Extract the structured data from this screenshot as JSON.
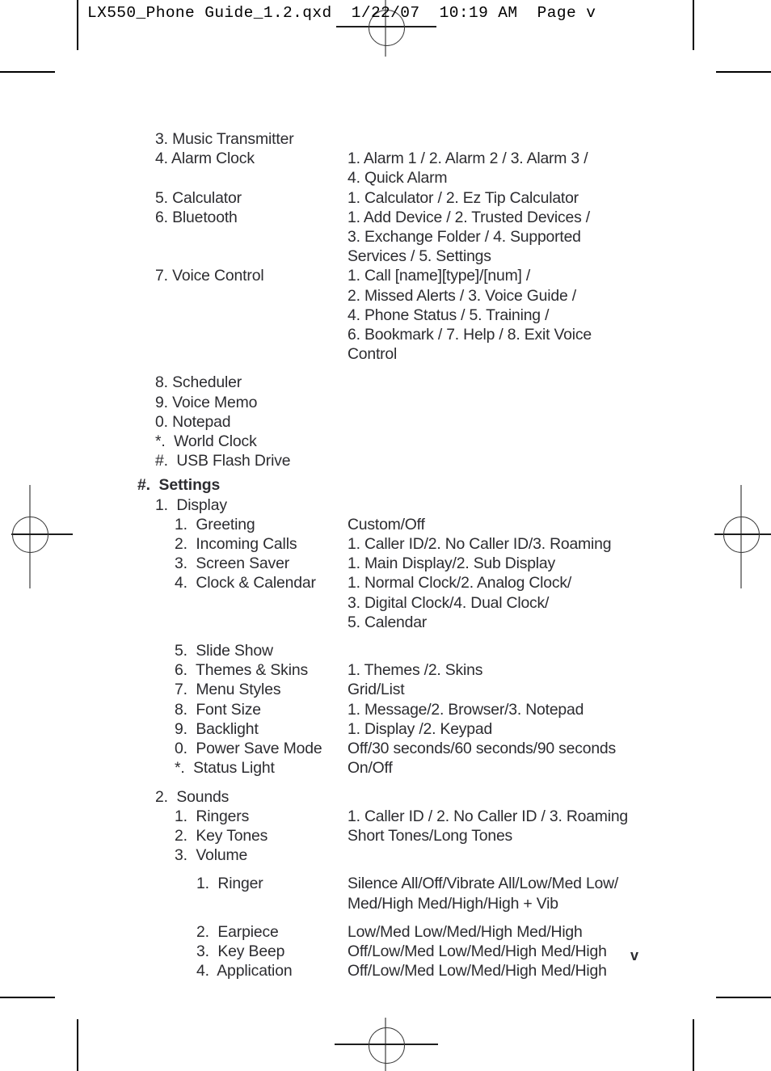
{
  "header": {
    "banner": "LX550_Phone Guide_1.2.qxd  1/22/07  10:19 AM  Page v"
  },
  "page_number": "v",
  "document": {
    "rows": [
      {
        "level": 1,
        "label": "3. Music Transmitter",
        "value": ""
      },
      {
        "level": 1,
        "label": "4. Alarm Clock",
        "value": "1. Alarm 1 / 2. Alarm 2 / 3. Alarm 3 /"
      },
      {
        "level": 1,
        "label": "",
        "value": "4. Quick Alarm"
      },
      {
        "level": 1,
        "label": "5. Calculator",
        "value": "1. Calculator / 2. Ez Tip Calculator"
      },
      {
        "level": 1,
        "label": "6. Bluetooth",
        "value": "1. Add Device / 2. Trusted Devices /"
      },
      {
        "level": 1,
        "label": "",
        "value": "3. Exchange Folder / 4. Supported"
      },
      {
        "level": 1,
        "label": "",
        "value": "Services / 5. Settings"
      },
      {
        "level": 1,
        "label": "7. Voice Control",
        "value": "1. Call [name][type]/[num] /"
      },
      {
        "level": 1,
        "label": "",
        "value": "2. Missed Alerts / 3. Voice Guide /"
      },
      {
        "level": 1,
        "label": "",
        "value": "4. Phone Status / 5. Training /"
      },
      {
        "level": 1,
        "label": "",
        "value": "6. Bookmark / 7. Help / 8. Exit Voice"
      },
      {
        "level": 1,
        "label": "",
        "value": "Control"
      },
      {
        "level": 1,
        "label": "8. Scheduler",
        "value": ""
      },
      {
        "level": 1,
        "label": "9. Voice Memo",
        "value": ""
      },
      {
        "level": 1,
        "label": "0. Notepad",
        "value": ""
      },
      {
        "level": 1,
        "label": "*.  World Clock",
        "value": ""
      },
      {
        "level": 1,
        "label": "#.  USB Flash Drive",
        "value": ""
      },
      {
        "level": 0,
        "label": "#.  Settings",
        "value": "",
        "bold": true
      },
      {
        "level": 2,
        "label": "1.  Display",
        "value": ""
      },
      {
        "level": 3,
        "label": "1.  Greeting",
        "value": "Custom/Off"
      },
      {
        "level": 3,
        "label": "2.  Incoming Calls",
        "value": "1. Caller ID/2. No Caller ID/3. Roaming"
      },
      {
        "level": 3,
        "label": "3.  Screen Saver",
        "value": "1. Main Display/2. Sub Display"
      },
      {
        "level": 3,
        "label": "4.  Clock & Calendar",
        "value": "1. Normal Clock/2. Analog Clock/"
      },
      {
        "level": 3,
        "label": "",
        "value": "3. Digital Clock/4. Dual Clock/"
      },
      {
        "level": 3,
        "label": "",
        "value": "5. Calendar"
      },
      {
        "level": 3,
        "label": "5.  Slide Show",
        "value": ""
      },
      {
        "level": 3,
        "label": "6.  Themes & Skins",
        "value": "1. Themes /2. Skins"
      },
      {
        "level": 3,
        "label": "7.  Menu Styles",
        "value": "Grid/List"
      },
      {
        "level": 3,
        "label": "8.  Font Size",
        "value": "1. Message/2. Browser/3. Notepad"
      },
      {
        "level": 3,
        "label": "9.  Backlight",
        "value": "1. Display /2. Keypad"
      },
      {
        "level": 3,
        "label": "0.  Power Save Mode",
        "value": "Off/30 seconds/60 seconds/90 seconds"
      },
      {
        "level": 3,
        "label": "*.  Status Light",
        "value": "On/Off"
      },
      {
        "level": 2,
        "label": "2.  Sounds",
        "value": ""
      },
      {
        "level": 3,
        "label": "1.  Ringers",
        "value": "1. Caller ID / 2. No Caller ID / 3. Roaming"
      },
      {
        "level": 3,
        "label": "2.  Key Tones",
        "value": "Short Tones/Long Tones"
      },
      {
        "level": 3,
        "label": "3.  Volume",
        "value": ""
      },
      {
        "level": 4,
        "label": "1.  Ringer",
        "value": "Silence All/Off/Vibrate All/Low/Med Low/"
      },
      {
        "level": 4,
        "label": "",
        "value": "Med/High Med/High/High + Vib"
      },
      {
        "level": 4,
        "label": "2.  Earpiece",
        "value": "Low/Med Low/Med/High Med/High"
      },
      {
        "level": 4,
        "label": "3.  Key Beep",
        "value": "Off/Low/Med Low/Med/High Med/High"
      },
      {
        "level": 4,
        "label": "4.  Application",
        "value": "Off/Low/Med Low/Med/High Med/High"
      }
    ]
  }
}
